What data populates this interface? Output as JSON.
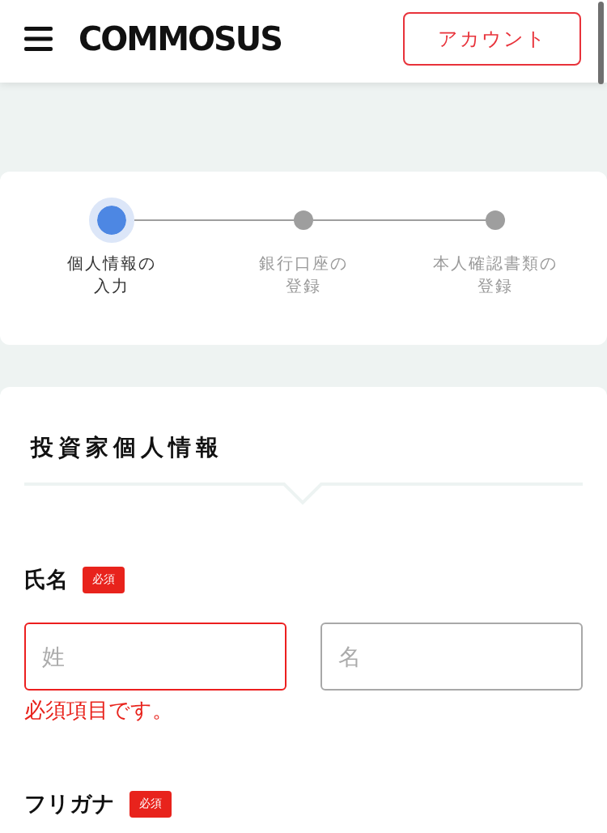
{
  "header": {
    "logo": "COMMOSUS",
    "account_button": "アカウント"
  },
  "stepper": {
    "steps": [
      {
        "label": "個人情報の入力",
        "active": true
      },
      {
        "label": "銀行口座の登録",
        "active": false
      },
      {
        "label": "本人確認書類の登録",
        "active": false
      }
    ]
  },
  "form": {
    "title": "投資家個人情報",
    "fields": [
      {
        "label": "氏名",
        "badge": "必須",
        "inputs": [
          {
            "placeholder": "姓",
            "invalid": true
          },
          {
            "placeholder": "名",
            "invalid": false
          }
        ],
        "error_message": "必須項目です。"
      },
      {
        "label": "フリガナ",
        "badge": "必須"
      }
    ]
  }
}
